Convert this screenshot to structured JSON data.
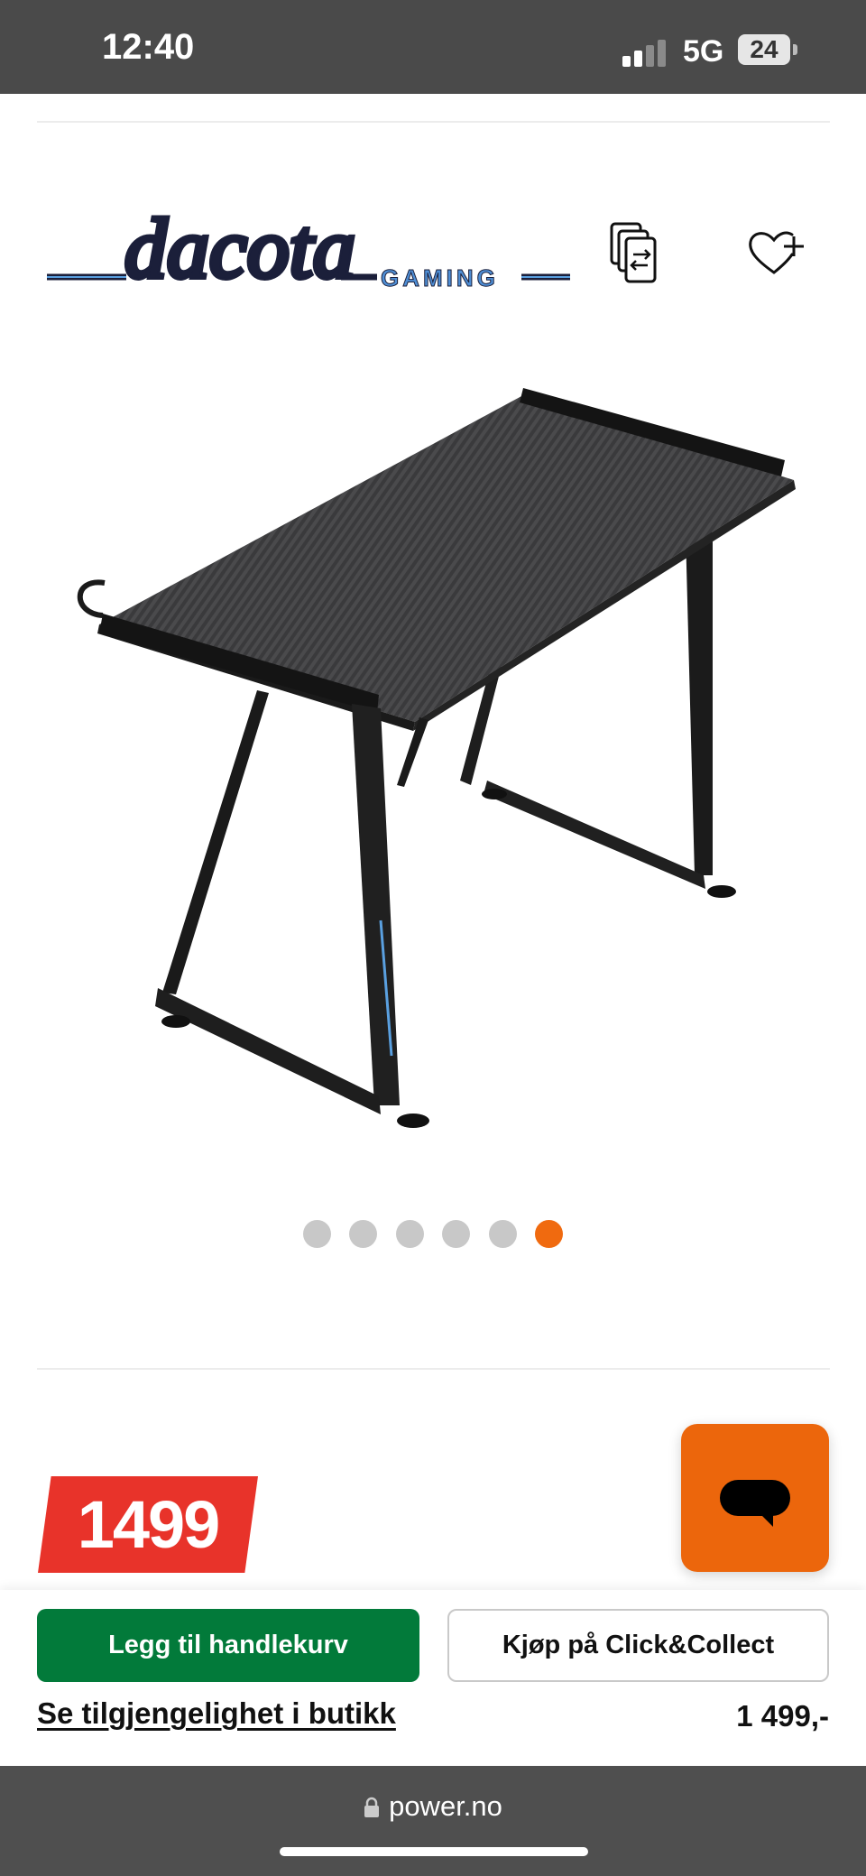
{
  "status_bar": {
    "time": "12:40",
    "network": "5G",
    "battery": "24",
    "signal_bars_filled": 2,
    "signal_bars_total": 4
  },
  "header": {
    "brand_name": "dacota",
    "brand_sub": "GAMING",
    "compare_icon": "compare-icon",
    "wishlist_icon": "heart-plus-icon"
  },
  "gallery": {
    "image_count": 6,
    "active_index": 5
  },
  "product": {
    "price_badge": "1499",
    "price": "1 499,-"
  },
  "actions": {
    "add_to_cart": "Legg til handlekurv",
    "click_collect": "Kjøp på Click&Collect",
    "store_availability": "Se tilgjengelighet i butikk"
  },
  "chat": {
    "icon": "chat-bubble-icon"
  },
  "browser": {
    "url": "power.no"
  },
  "colors": {
    "accent_orange": "#ec660c",
    "cart_green": "#027a3a",
    "price_red": "#e8332a"
  }
}
